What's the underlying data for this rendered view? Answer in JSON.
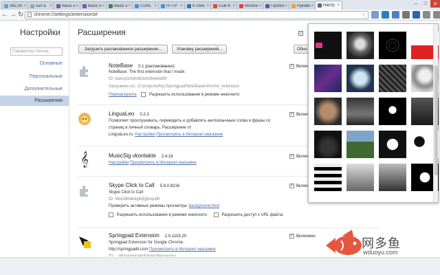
{
  "tabs": [
    {
      "label": "392,00",
      "favicon_color": "#6a9fd5"
    },
    {
      "label": "curl a",
      "favicon_color": "#9aa5b1"
    },
    {
      "label": "Basic a",
      "favicon_color": "#7a58a8"
    },
    {
      "label": "Basic a",
      "favicon_color": "#7a58a8"
    },
    {
      "label": "Basic a",
      "favicon_color": "#3c8a4e"
    },
    {
      "label": "CURL",
      "favicon_color": "#4c8fd6"
    },
    {
      "label": "HTTP",
      "favicon_color": "#4c8fd6"
    },
    {
      "label": "К спис",
      "favicon_color": "#3b6fb5"
    },
    {
      "label": "Cuili K",
      "favicon_color": "#d84a3a"
    },
    {
      "label": "Исполн",
      "favicon_color": "#d84a3a"
    },
    {
      "label": "Пробле",
      "favicon_color": "#5a5a9e"
    },
    {
      "label": "Руково",
      "favicon_color": "#f0a030"
    },
    {
      "label": "Настр",
      "favicon_color": "#666666"
    }
  ],
  "toolbar": {
    "url": "chrome://settings/extensions#",
    "star_icon": "star-icon",
    "extension_icons": [
      {
        "name": "puzzle-icon",
        "color": "#7a9ad0"
      },
      {
        "name": "drop-icon",
        "color": "#2f7dbf"
      },
      {
        "name": "translate-icon",
        "color": "#4b80c4"
      },
      {
        "name": "music-icon",
        "color": "#777777"
      },
      {
        "name": "window-icon",
        "color": "#2d62b0"
      },
      {
        "name": "gear-icon",
        "color": "#8a8a8a"
      },
      {
        "name": "wrench-icon",
        "color": "#8a8a8a"
      }
    ]
  },
  "sidebar": {
    "title": "Настройки",
    "search_placeholder": "Параметры поиска",
    "items": [
      "Основные",
      "Персональные",
      "Дополнительные",
      "Расширения"
    ]
  },
  "main": {
    "title": "Расширения",
    "load_button": "Загрузить распакованное расширение...",
    "pack_button": "Упаковку расширений...",
    "update_button": "Обно",
    "enabled_label": "Включ",
    "enabled_label_full": "Включено"
  },
  "extensions": [
    {
      "name": "NoteBase",
      "version": "0.1  (распакованно)",
      "description": "NoteBase: The first extension that I made.",
      "id": "ID: kalcicjocfahdbcbdcfbeekafbf",
      "path": "Загружено из:: G:/projects/MyJSpringpad/NoteBase/chrome_extension",
      "reload": "Перезагрузить",
      "incognito": "Разрешить использование в режиме инкогнито"
    },
    {
      "name": "LinguaLeo",
      "version": "0.2.3",
      "line1": "Позволяет прослушивать, переводить и добавлять англоязычные слова и фразы со",
      "line2": "страниц в личный словарь. Расширение от",
      "site": "LinguaLeo.ru.",
      "settings": "Настройки",
      "view_store": "Просмотреть в Интернет-магазине"
    },
    {
      "name": "MusicSig vkontakte",
      "version": "2.4.16",
      "settings": "Настройки",
      "view_store": "Просмотреть в Интернет-магазине"
    },
    {
      "name": "Skype Click to Call",
      "version": "5.9.0.9216",
      "description": "Skype Click to Call",
      "id": "ID: lifbcibllhdkdgihjfgfpnpidfl",
      "views_label": "Проверить активные режимы просмотра:",
      "views_link": "background.html",
      "incognito": "Разрешить использование в режиме инкогнито",
      "file_access": "Разрешить доступ к URL файла"
    },
    {
      "name": "Springpad Extension",
      "version": "2.5.1103.20",
      "description": "Springpad Extension for Google Chrome.",
      "site": "http://springpadit.com",
      "view_store": "Просмотреть в Интернет-магазине",
      "id": "ID: ...pfnnanmjpaknlpkgeohhoseomo"
    }
  ],
  "watermark": {
    "cn": "网多鱼",
    "url": "wduoyu.com",
    "fish_color": "#e8563f"
  },
  "popup": {
    "image_count": 20
  }
}
